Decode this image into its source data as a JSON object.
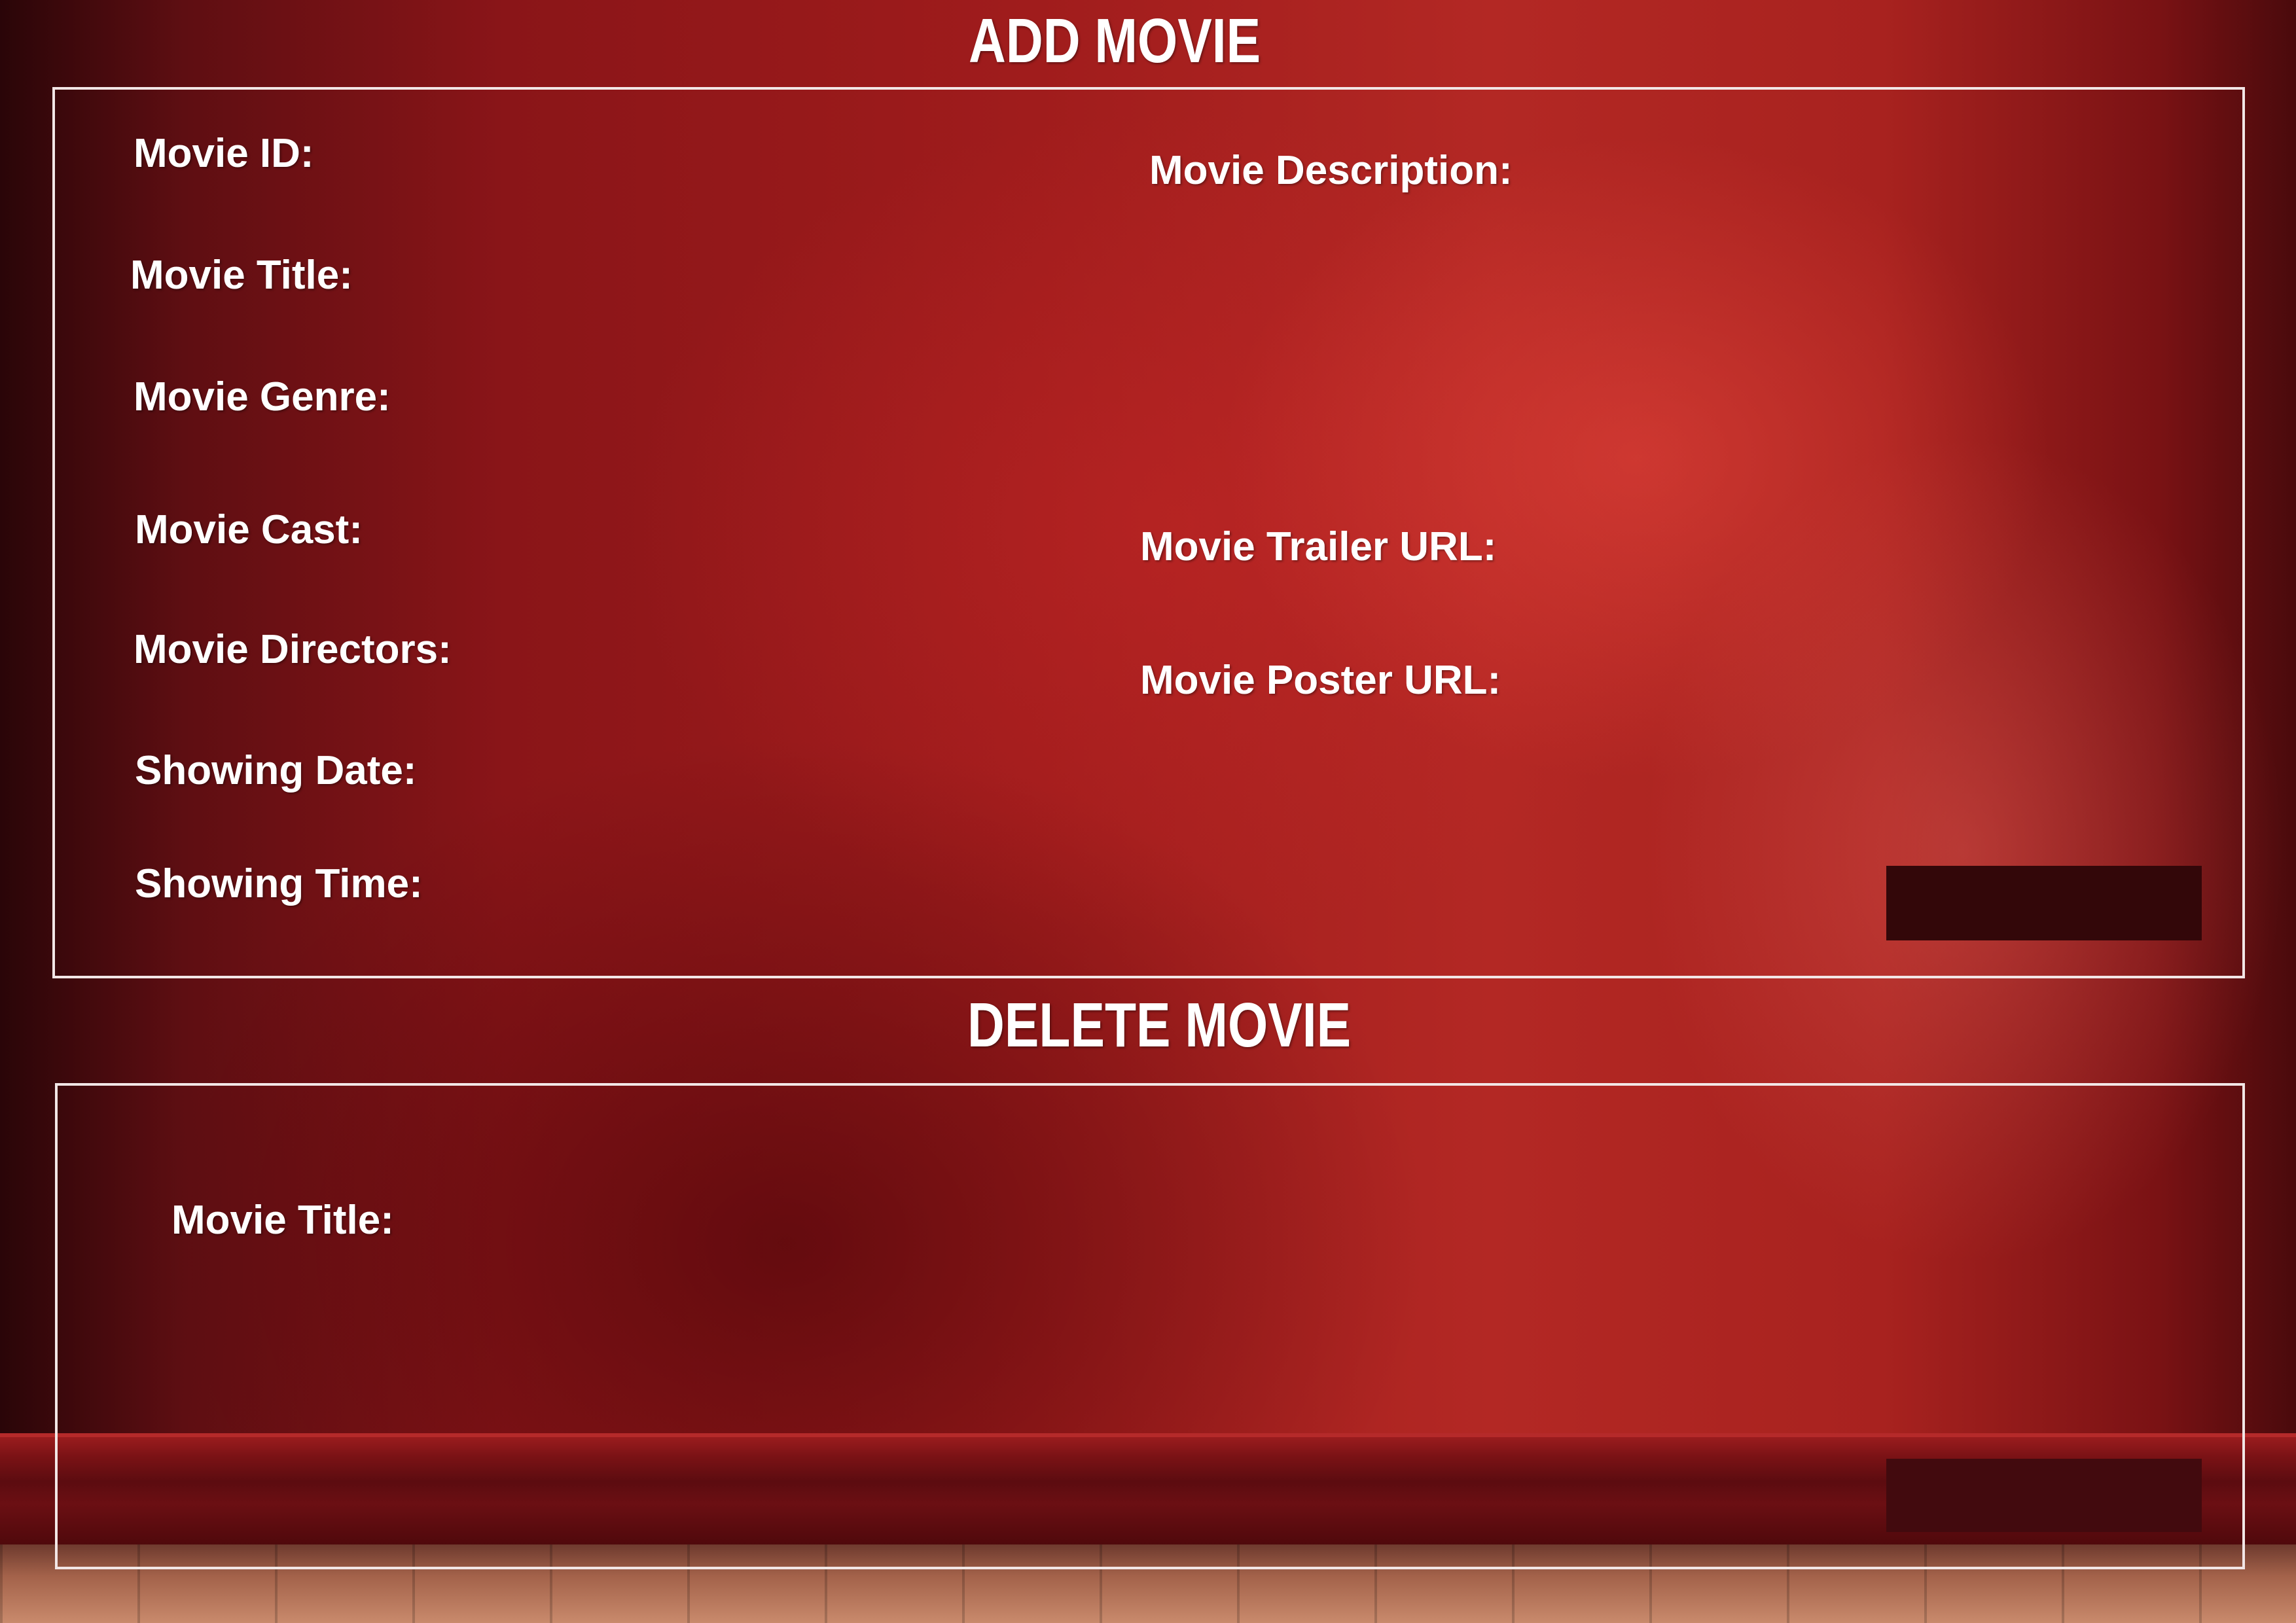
{
  "add_movie": {
    "title": "ADD MOVIE",
    "labels": {
      "movie_id": "Movie ID:",
      "movie_title": "Movie Title:",
      "movie_genre": "Movie Genre:",
      "movie_cast": "Movie Cast:",
      "movie_directors": "Movie Directors:",
      "showing_date": "Showing Date:",
      "showing_time": "Showing Time:",
      "movie_description": "Movie Description:",
      "movie_trailer_url": "Movie Trailer URL:",
      "movie_poster_url": "Movie Poster URL:"
    }
  },
  "delete_movie": {
    "title": "DELETE MOVIE",
    "labels": {
      "movie_title": "Movie Title:"
    }
  },
  "colors": {
    "panel_border": "#f2e6e6",
    "button_fill": "#330709",
    "text": "#ffffff"
  }
}
